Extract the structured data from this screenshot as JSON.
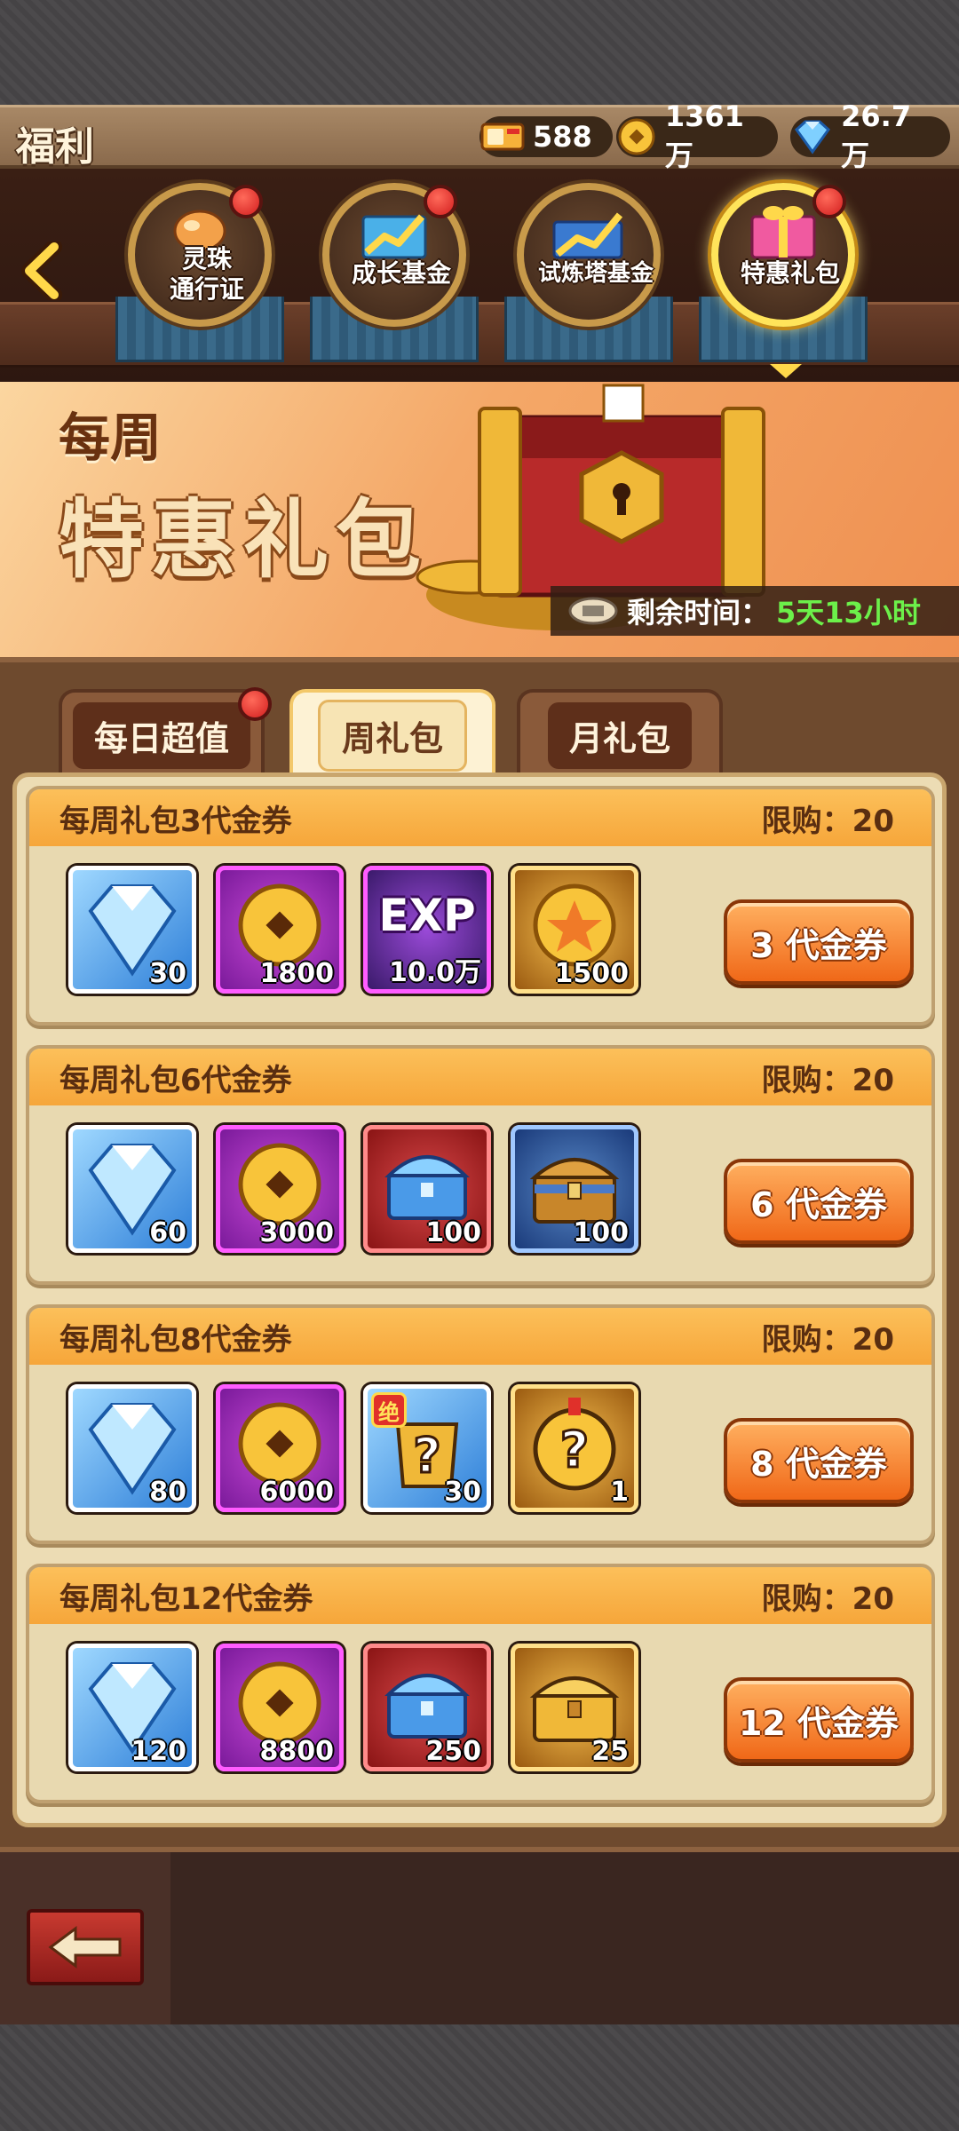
{
  "header": {
    "title": "福利",
    "currencies": {
      "ticket": "588",
      "coin": "1361万",
      "gem": "26.7万"
    }
  },
  "nav": {
    "items": [
      {
        "line1": "灵珠",
        "line2": "通行证",
        "badge": true
      },
      {
        "line1": "成长基金",
        "line2": "",
        "badge": true
      },
      {
        "line1": "试炼塔基金",
        "line2": "",
        "badge": false
      },
      {
        "line1": "特惠礼包",
        "line2": "",
        "badge": true,
        "active": true
      }
    ]
  },
  "banner": {
    "line1": "每周",
    "line2": "特惠礼包",
    "timer_label": "剩余时间：",
    "timer_value": "5天13小时"
  },
  "tabs": {
    "daily": "每日超值",
    "weekly": "周礼包",
    "monthly": "月礼包"
  },
  "packs": [
    {
      "title": "每周礼包3代金券",
      "limit": "限购：20",
      "price": "3 代金券",
      "items": [
        {
          "icon": "diamond-icon",
          "qty": "30"
        },
        {
          "icon": "gold-coin-icon",
          "qty": "1800"
        },
        {
          "icon": "exp-icon",
          "qty": "10.0万",
          "label": "EXP"
        },
        {
          "icon": "star-coin-icon",
          "qty": "1500"
        }
      ]
    },
    {
      "title": "每周礼包6代金券",
      "limit": "限购：20",
      "price": "6 代金券",
      "items": [
        {
          "icon": "diamond-icon",
          "qty": "60"
        },
        {
          "icon": "gold-coin-icon",
          "qty": "3000"
        },
        {
          "icon": "crystal-chest-icon",
          "qty": "100"
        },
        {
          "icon": "treasure-chest-icon",
          "qty": "100"
        }
      ]
    },
    {
      "title": "每周礼包8代金券",
      "limit": "限购：20",
      "price": "8 代金券",
      "items": [
        {
          "icon": "diamond-icon",
          "qty": "80"
        },
        {
          "icon": "gold-coin-icon",
          "qty": "6000"
        },
        {
          "icon": "mystery-hero-icon",
          "qty": "30",
          "badge": "绝"
        },
        {
          "icon": "mystery-medal-icon",
          "qty": "1"
        }
      ]
    },
    {
      "title": "每周礼包12代金券",
      "limit": "限购：20",
      "price": "12 代金券",
      "items": [
        {
          "icon": "diamond-icon",
          "qty": "120"
        },
        {
          "icon": "gold-coin-icon",
          "qty": "8800"
        },
        {
          "icon": "crystal-chest-icon",
          "qty": "250"
        },
        {
          "icon": "gold-chest-icon",
          "qty": "25"
        }
      ]
    }
  ]
}
